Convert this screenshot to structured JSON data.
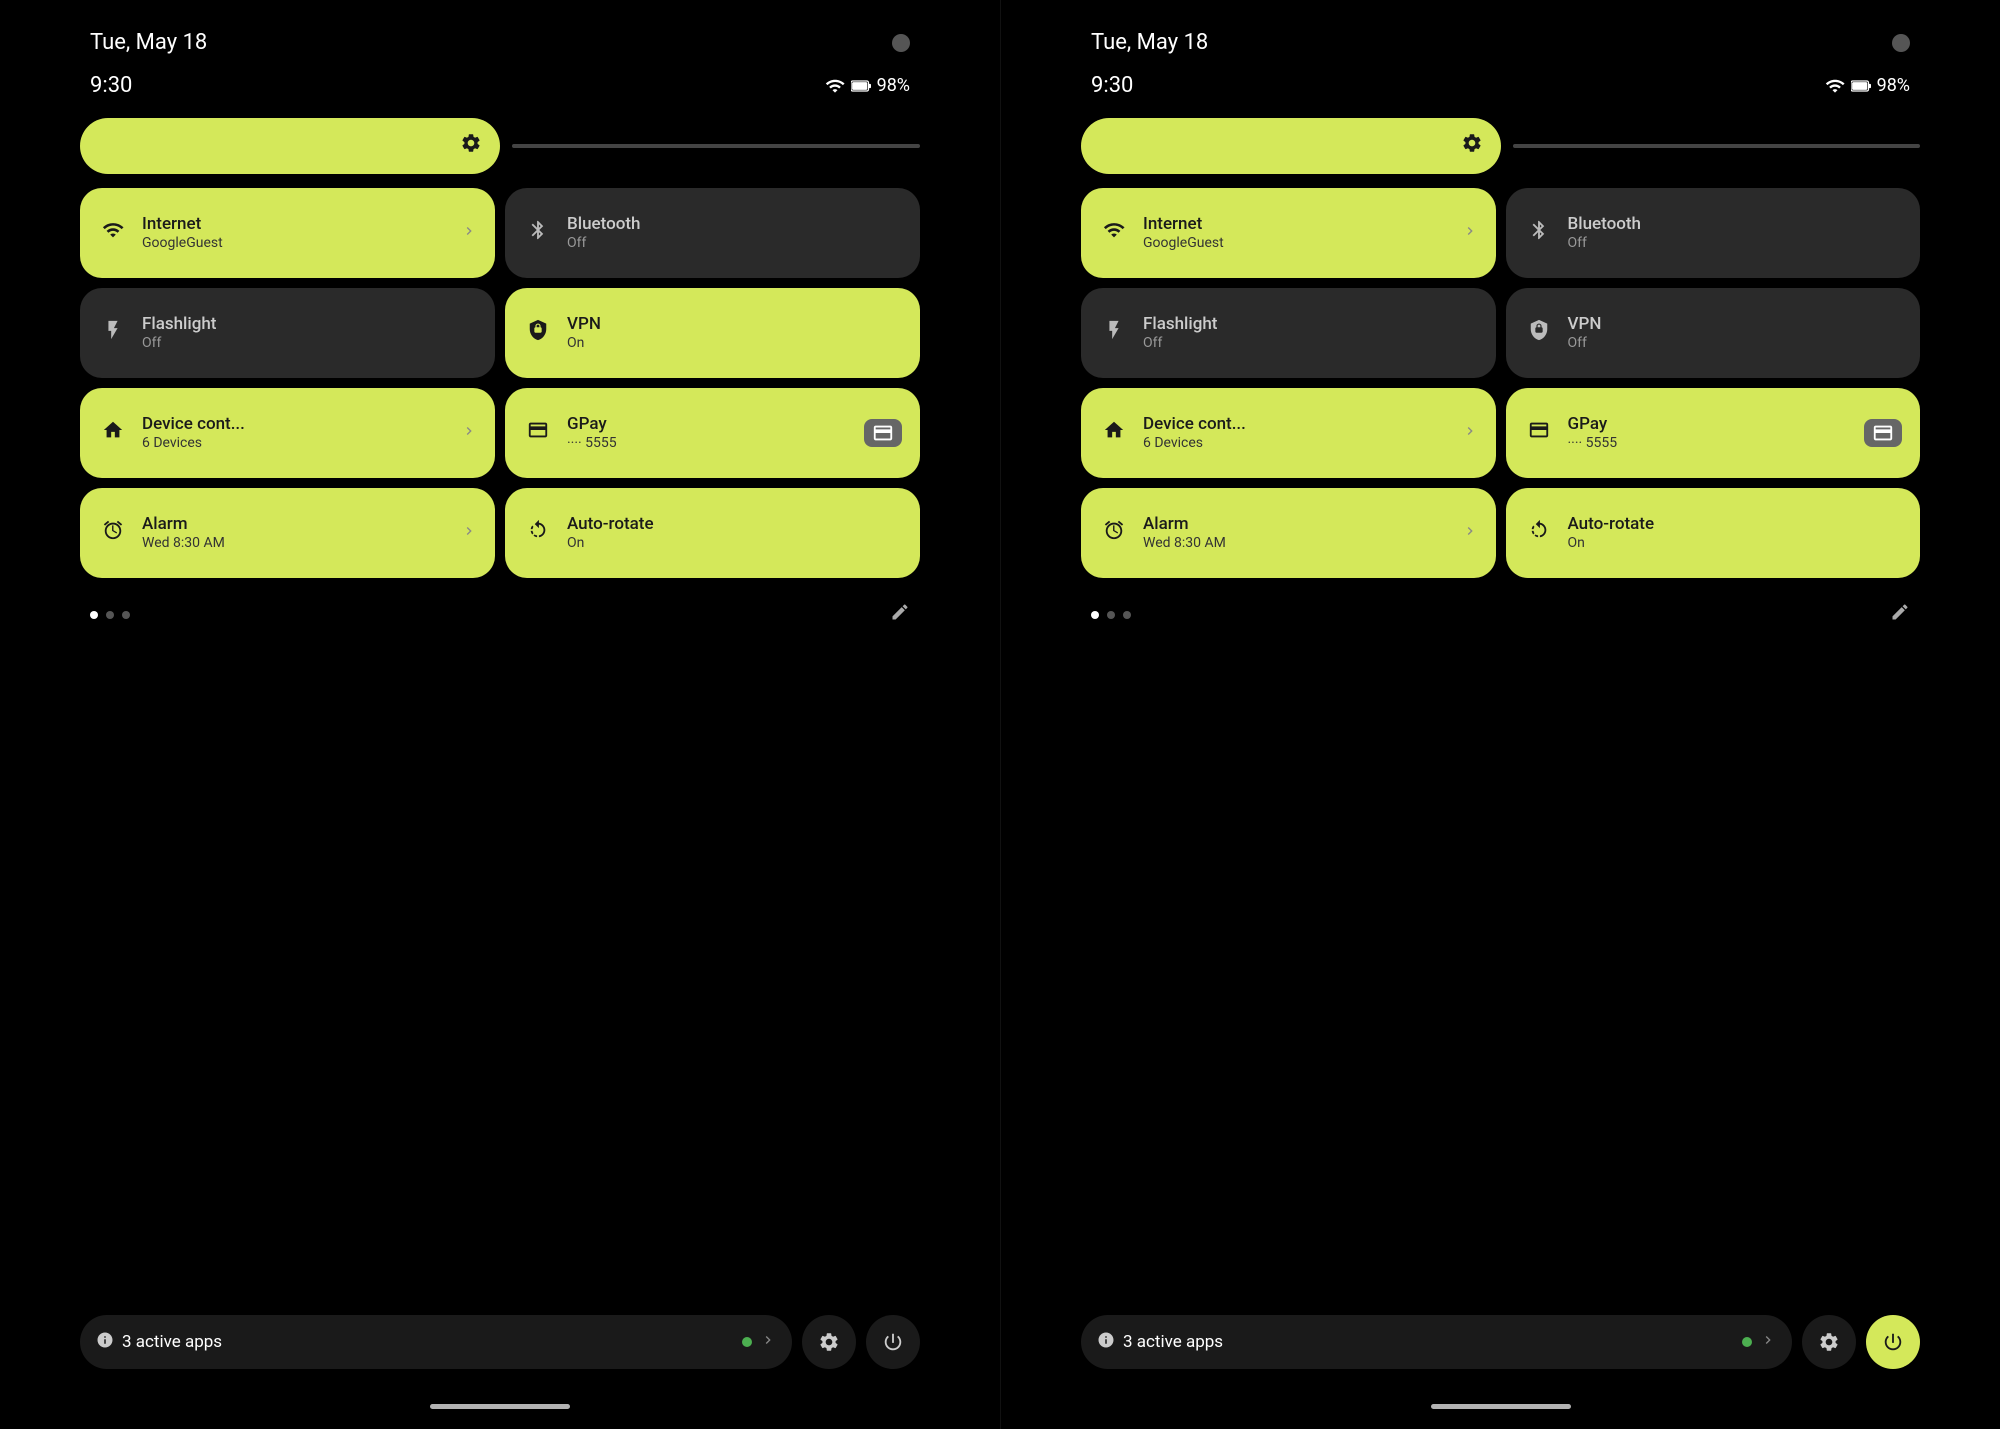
{
  "panels": [
    {
      "id": "panel-left",
      "status": {
        "date": "Tue, May 18",
        "time": "9:30",
        "battery": "98%",
        "wifi_icon": "wifi",
        "battery_icon": "battery"
      },
      "brightness": {
        "aria": "Brightness slider"
      },
      "tiles": [
        {
          "id": "internet",
          "active": true,
          "title": "Internet",
          "subtitle": "GoogleGuest",
          "icon": "wifi",
          "has_chevron": true
        },
        {
          "id": "bluetooth",
          "active": false,
          "title": "Bluetooth",
          "subtitle": "Off",
          "icon": "bt",
          "has_chevron": false
        },
        {
          "id": "flashlight",
          "active": false,
          "title": "Flashlight",
          "subtitle": "Off",
          "icon": "flashlight",
          "has_chevron": false
        },
        {
          "id": "vpn",
          "active": true,
          "title": "VPN",
          "subtitle": "On",
          "icon": "vpn",
          "has_chevron": false
        },
        {
          "id": "device-control",
          "active": true,
          "title": "Device cont...",
          "subtitle": "6 Devices",
          "icon": "home",
          "has_chevron": true
        },
        {
          "id": "gpay",
          "active": true,
          "title": "GPay",
          "subtitle": "···· 5555",
          "icon": "card",
          "has_chevron": false,
          "has_badge": true
        },
        {
          "id": "alarm",
          "active": true,
          "title": "Alarm",
          "subtitle": "Wed 8:30 AM",
          "icon": "alarm",
          "has_chevron": true
        },
        {
          "id": "autorotate",
          "active": true,
          "title": "Auto-rotate",
          "subtitle": "On",
          "icon": "rotate",
          "has_chevron": false
        }
      ],
      "dots": [
        true,
        false,
        false
      ],
      "bottom": {
        "active_apps_count": "3",
        "active_apps_label": "active apps",
        "settings_icon": "gear",
        "power_icon": "power",
        "power_active": false
      }
    },
    {
      "id": "panel-right",
      "status": {
        "date": "Tue, May 18",
        "time": "9:30",
        "battery": "98%"
      },
      "brightness": {
        "aria": "Brightness slider"
      },
      "tiles": [
        {
          "id": "internet",
          "active": true,
          "title": "Internet",
          "subtitle": "GoogleGuest",
          "icon": "wifi",
          "has_chevron": true
        },
        {
          "id": "bluetooth",
          "active": false,
          "title": "Bluetooth",
          "subtitle": "Off",
          "icon": "bt",
          "has_chevron": false
        },
        {
          "id": "flashlight",
          "active": false,
          "title": "Flashlight",
          "subtitle": "Off",
          "icon": "flashlight",
          "has_chevron": false
        },
        {
          "id": "vpn",
          "active": false,
          "title": "VPN",
          "subtitle": "Off",
          "icon": "vpn",
          "has_chevron": false
        },
        {
          "id": "device-control",
          "active": true,
          "title": "Device cont...",
          "subtitle": "6 Devices",
          "icon": "home",
          "has_chevron": true
        },
        {
          "id": "gpay",
          "active": true,
          "title": "GPay",
          "subtitle": "···· 5555",
          "icon": "card",
          "has_chevron": false,
          "has_badge": true
        },
        {
          "id": "alarm",
          "active": true,
          "title": "Alarm",
          "subtitle": "Wed 8:30 AM",
          "icon": "alarm",
          "has_chevron": true
        },
        {
          "id": "autorotate",
          "active": true,
          "title": "Auto-rotate",
          "subtitle": "On",
          "icon": "rotate",
          "has_chevron": false
        }
      ],
      "dots": [
        true,
        false,
        false
      ],
      "bottom": {
        "active_apps_count": "3",
        "active_apps_label": "active apps",
        "settings_icon": "gear",
        "power_icon": "power",
        "power_active": true
      }
    }
  ]
}
